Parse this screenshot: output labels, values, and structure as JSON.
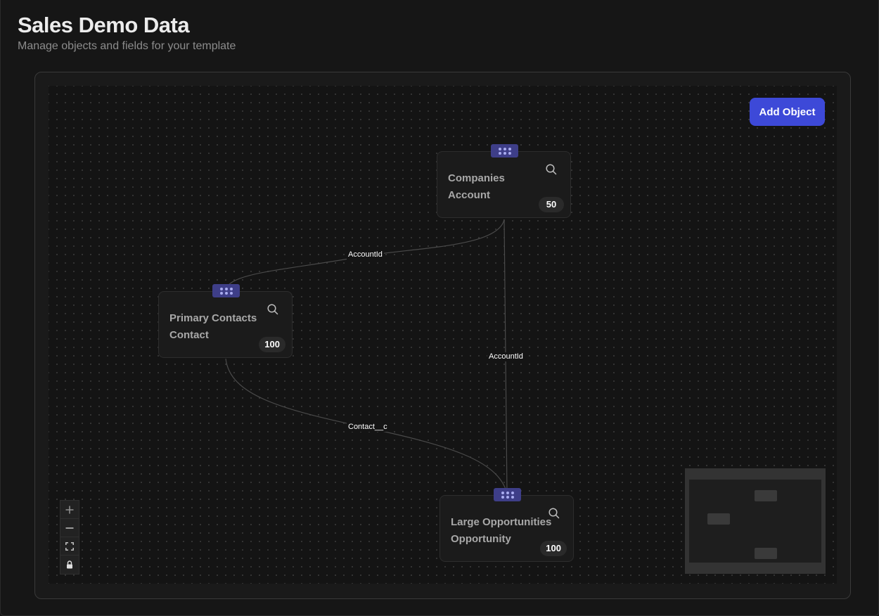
{
  "header": {
    "title": "Sales Demo Data",
    "subtitle": "Manage objects and fields for your template"
  },
  "toolbar": {
    "add_object_label": "Add Object"
  },
  "nodes": [
    {
      "id": "companies",
      "title": "Companies",
      "api_name": "Account",
      "count": "50",
      "icon": "search-icon"
    },
    {
      "id": "contacts",
      "title": "Primary Contacts",
      "api_name": "Contact",
      "count": "100",
      "icon": "search-icon"
    },
    {
      "id": "opportunities",
      "title": "Large Opportunities",
      "api_name": "Opportunity",
      "count": "100",
      "icon": "search-icon"
    }
  ],
  "edges": [
    {
      "source": "companies",
      "target": "contacts",
      "label": "AccountId"
    },
    {
      "source": "companies",
      "target": "opportunities",
      "label": "AccountId"
    },
    {
      "source": "contacts",
      "target": "opportunities",
      "label": "Contact__c"
    }
  ],
  "controls": [
    {
      "name": "zoom-in",
      "icon": "plus-icon"
    },
    {
      "name": "zoom-out",
      "icon": "minus-icon"
    },
    {
      "name": "fit-view",
      "icon": "fit-view-icon"
    },
    {
      "name": "lock",
      "icon": "lock-icon"
    }
  ],
  "colors": {
    "accent": "#3d49d8",
    "handle": "#3e3e88",
    "background": "#161616"
  }
}
